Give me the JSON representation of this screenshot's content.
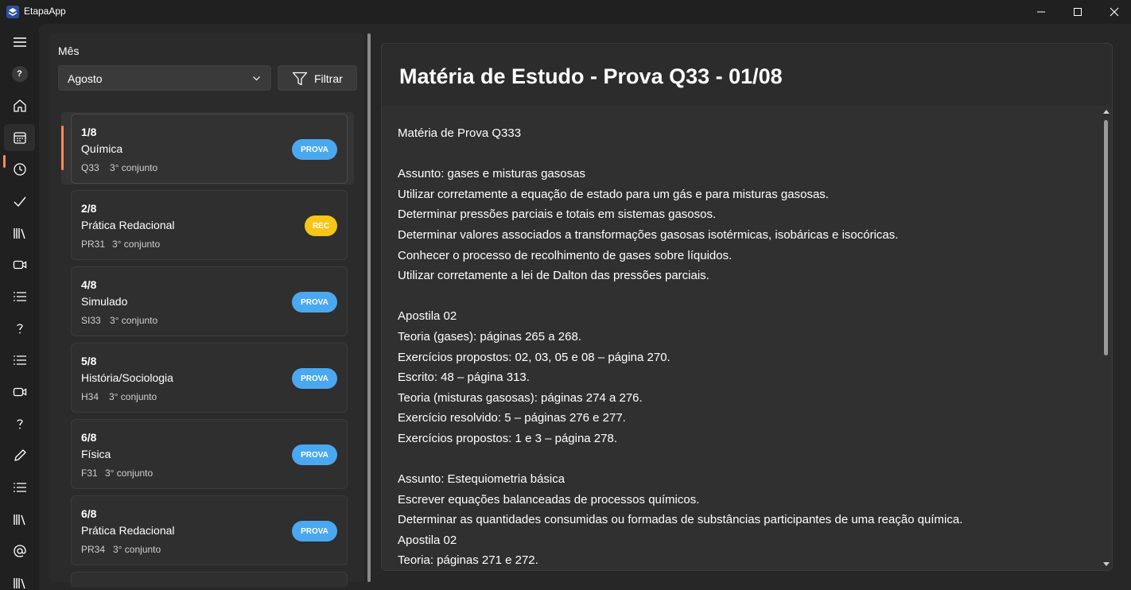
{
  "window": {
    "title": "EtapaApp",
    "icon": "etapa-logo-icon",
    "controls": [
      "minimize-icon",
      "maximize-icon",
      "close-icon"
    ]
  },
  "nav": {
    "items": [
      "hamburger-menu-icon",
      "help-icon",
      "home-icon",
      "calendar-icon",
      "clock-icon",
      "checkmark-icon",
      "library-icon",
      "video-icon",
      "list-icon",
      "question-icon",
      "list-icon",
      "video-icon",
      "question-icon",
      "pencil-icon",
      "list-icon",
      "library-icon",
      "at-sign-icon",
      "library-icon"
    ],
    "help_glyph": "?",
    "selected": "calendar-icon"
  },
  "filter": {
    "month_label": "Mês",
    "month_value": "Agosto",
    "filter_button": "Filtrar"
  },
  "cards": [
    {
      "date": "1/8",
      "subject": "Química",
      "code": "Q33",
      "group": "3° conjunto",
      "badge": "PROVA",
      "badge_type": "prova",
      "selected": true
    },
    {
      "date": "2/8",
      "subject": "Prática Redacional",
      "code": "PR31",
      "group": "3° conjunto",
      "badge": "REC",
      "badge_type": "rec"
    },
    {
      "date": "4/8",
      "subject": "Simulado",
      "code": "SI33",
      "group": "3° conjunto",
      "badge": "PROVA",
      "badge_type": "prova"
    },
    {
      "date": "5/8",
      "subject": "História/Sociologia",
      "code": "H34",
      "group": "3° conjunto",
      "badge": "PROVA",
      "badge_type": "prova"
    },
    {
      "date": "6/8",
      "subject": "Física",
      "code": "F31",
      "group": "3° conjunto",
      "badge": "PROVA",
      "badge_type": "prova"
    },
    {
      "date": "6/8",
      "subject": "Prática Redacional",
      "code": "PR34",
      "group": "3° conjunto",
      "badge": "PROVA",
      "badge_type": "prova"
    }
  ],
  "detail": {
    "title": "Matéria de Estudo - Prova Q33 - 01/08",
    "lines": [
      "Matéria de Prova Q333",
      "",
      "Assunto: gases e misturas gasosas",
      "Utilizar corretamente a equação de estado para um gás e para misturas gasosas.",
      "Determinar pressões parciais e totais em sistemas gasosos.",
      "Determinar valores associados a transformações gasosas isotérmicas, isobáricas e isocóricas.",
      "Conhecer o processo de recolhimento de gases sobre líquidos.",
      "Utilizar corretamente a lei de Dalton das pressões parciais.",
      "",
      "Apostila 02",
      "Teoria (gases): páginas 265 a 268.",
      "Exercícios propostos: 02, 03, 05 e 08 – página 270.",
      "Escrito: 48 – página 313.",
      "Teoria (misturas gasosas): páginas 274 a 276.",
      "Exercício resolvido: 5 – páginas 276 e 277.",
      "Exercícios propostos: 1 e 3 – página 278.",
      "",
      "Assunto: Estequiometria básica",
      "Escrever equações balanceadas de processos químicos.",
      "Determinar as quantidades consumidas ou formadas de substâncias participantes de uma reação química.",
      "Apostila 02",
      "Teoria: páginas 271 e 272."
    ]
  },
  "colors": {
    "accent": "#ff8a5c",
    "prova_badge": "#4aa8f0",
    "rec_badge": "#f5c518"
  }
}
